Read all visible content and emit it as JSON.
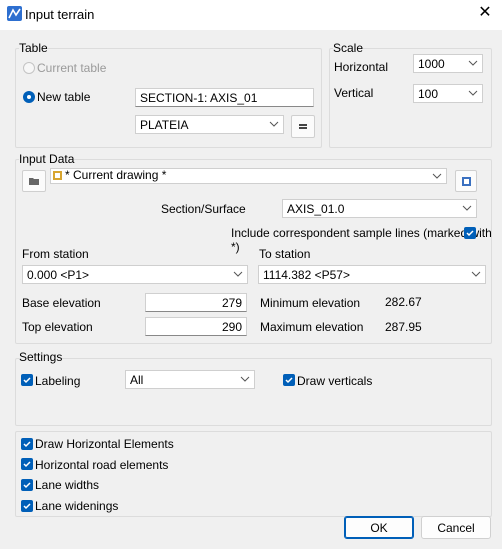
{
  "window": {
    "title": "Input terrain",
    "close_glyph": "✕"
  },
  "table": {
    "group_label": "Table",
    "current_table_label": "Current table",
    "new_table_label": "New table",
    "name_value": "SECTION-1: AXIS_01",
    "layer_value": "PLATEIA",
    "new_table_selected": true
  },
  "scale": {
    "group_label": "Scale",
    "horizontal_label": "Horizontal",
    "horizontal_value": "1000",
    "vertical_label": "Vertical",
    "vertical_value": "100"
  },
  "input_data": {
    "group_label": "Input Data",
    "drawing_value": "* Current drawing *",
    "section_surface_label": "Section/Surface",
    "section_surface_value": "AXIS_01.0",
    "include_lines_label": "Include correspondent sample lines (marked with *)",
    "include_lines_checked": true,
    "from_station_label": "From station",
    "from_station_value": "0.000 <P1>",
    "to_station_label": "To station",
    "to_station_value": "1114.382 <P57>",
    "base_elevation_label": "Base elevation",
    "base_elevation_value": "279",
    "top_elevation_label": "Top elevation",
    "top_elevation_value": "290",
    "min_elevation_label": "Minimum elevation",
    "min_elevation_value": "282.67",
    "max_elevation_label": "Maximum elevation",
    "max_elevation_value": "287.95"
  },
  "settings": {
    "group_label": "Settings",
    "labeling_label": "Labeling",
    "labeling_checked": true,
    "labeling_value": "All",
    "draw_verticals_label": "Draw verticals",
    "draw_verticals_checked": true
  },
  "options": {
    "draw_horizontal_label": "Draw Horizontal Elements",
    "horizontal_road_label": "Horizontal road elements",
    "lane_widths_label": "Lane widths",
    "lane_widenings_label": "Lane widenings"
  },
  "buttons": {
    "ok": "OK",
    "cancel": "Cancel"
  },
  "colors": {
    "accent": "#005fb8"
  }
}
